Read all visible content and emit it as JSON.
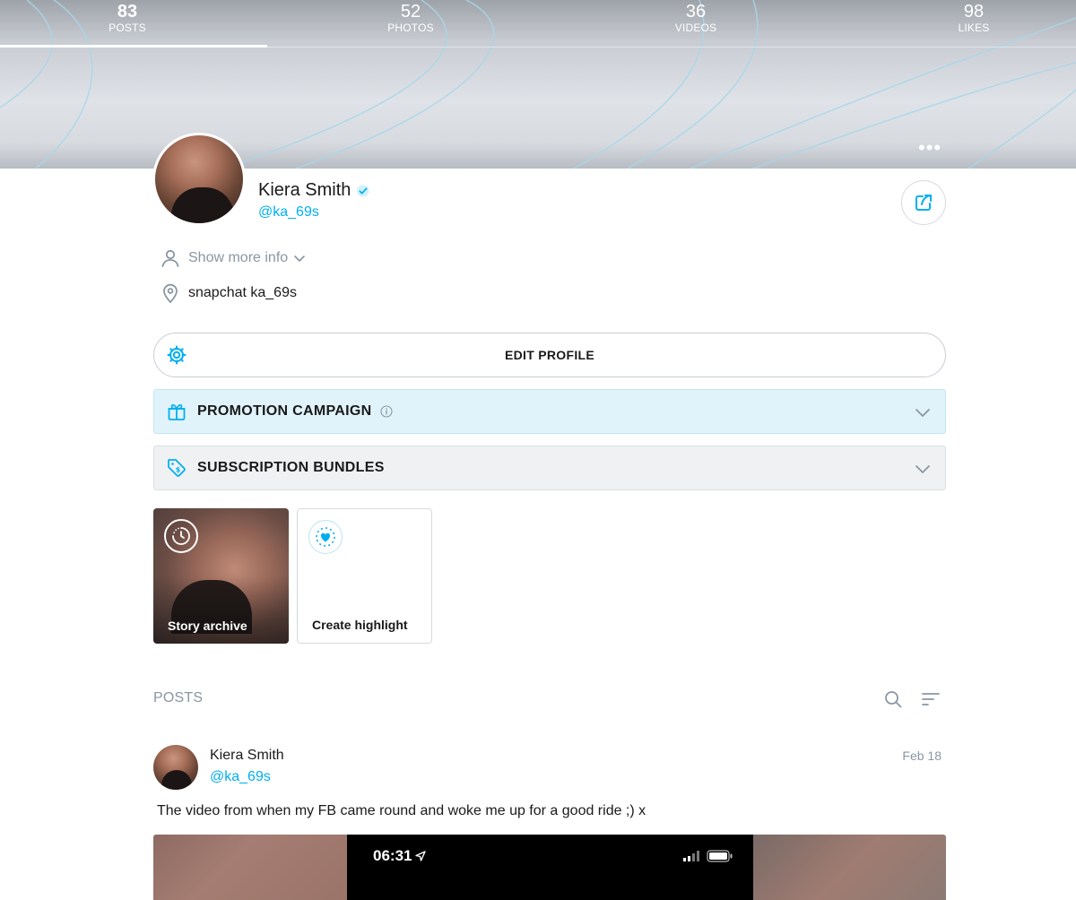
{
  "stats": [
    {
      "value": "83",
      "label": "POSTS",
      "active": true
    },
    {
      "value": "52",
      "label": "PHOTOS",
      "active": false
    },
    {
      "value": "36",
      "label": "VIDEOS",
      "active": false
    },
    {
      "value": "98",
      "label": "LIKES",
      "active": false
    }
  ],
  "cover": {
    "more_icon": "more-horizontal-icon"
  },
  "profile": {
    "name": "Kiera Smith",
    "handle": "@ka_69s",
    "verified": true,
    "show_more_label": "Show more info",
    "location": "snapchat ka_69s"
  },
  "actions": {
    "edit_profile_label": "EDIT PROFILE",
    "promotion_label": "PROMOTION CAMPAIGN",
    "bundles_label": "SUBSCRIPTION BUNDLES"
  },
  "highlights": [
    {
      "label": "Story archive",
      "icon": "clock-icon"
    },
    {
      "label": "Create highlight",
      "icon": "heart-plus-icon"
    }
  ],
  "posts_section": {
    "title": "POSTS"
  },
  "post": {
    "author_name": "Kiera Smith",
    "author_handle": "@ka_69s",
    "date": "Feb 18",
    "text": "The video from when my FB came round and woke me up for a good ride ;) x",
    "media_time": "06:31"
  },
  "colors": {
    "accent": "#00aff0",
    "muted": "#8a96a3",
    "promo_bg": "#e0f3fb",
    "bundles_bg": "#eff1f3"
  }
}
